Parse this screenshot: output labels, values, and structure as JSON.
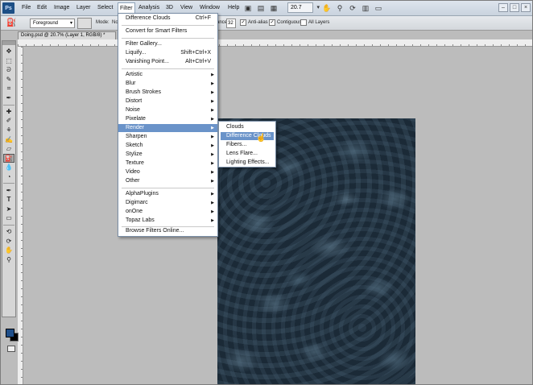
{
  "app": {
    "logo": "Ps"
  },
  "menubar": {
    "items": [
      "File",
      "Edit",
      "Image",
      "Layer",
      "Select",
      "Filter",
      "Analysis",
      "3D",
      "View",
      "Window",
      "Help"
    ],
    "zoom": "20.7"
  },
  "options": {
    "fill_source": "Foreground",
    "mode_label": "Mode:",
    "mode_value": "No",
    "tolerance_label": "ance:",
    "tolerance_value": "32",
    "anti_alias": "Anti-alias",
    "contiguous": "Contiguous",
    "all_layers": "All Layers"
  },
  "document": {
    "tab_title": "Doing.psd @ 20.7% (Layer 1, RGB/8) *"
  },
  "filter_menu": {
    "last_filter": {
      "label": "Difference Clouds",
      "shortcut": "Ctrl+F"
    },
    "smart": "Convert for Smart Filters",
    "gallery": "Filter Gallery...",
    "liquify": {
      "label": "Liquify...",
      "shortcut": "Shift+Ctrl+X"
    },
    "vanishing": {
      "label": "Vanishing Point...",
      "shortcut": "Alt+Ctrl+V"
    },
    "groups": [
      "Artistic",
      "Blur",
      "Brush Strokes",
      "Distort",
      "Noise",
      "Pixelate",
      "Render",
      "Sharpen",
      "Sketch",
      "Stylize",
      "Texture",
      "Video",
      "Other"
    ],
    "plugins": [
      "AlphaPlugins",
      "Digimarc",
      "onOne",
      "Topaz Labs"
    ],
    "browse": "Browse Filters Online...",
    "highlighted": "Render"
  },
  "render_submenu": {
    "items": [
      "Clouds",
      "Difference Clouds",
      "Fibers...",
      "Lens Flare...",
      "Lighting Effects..."
    ],
    "highlighted": "Difference Clouds"
  },
  "colors": {
    "foreground": "#1f4f8a",
    "background": "#000000",
    "menu_highlight": "#6a93c9"
  }
}
